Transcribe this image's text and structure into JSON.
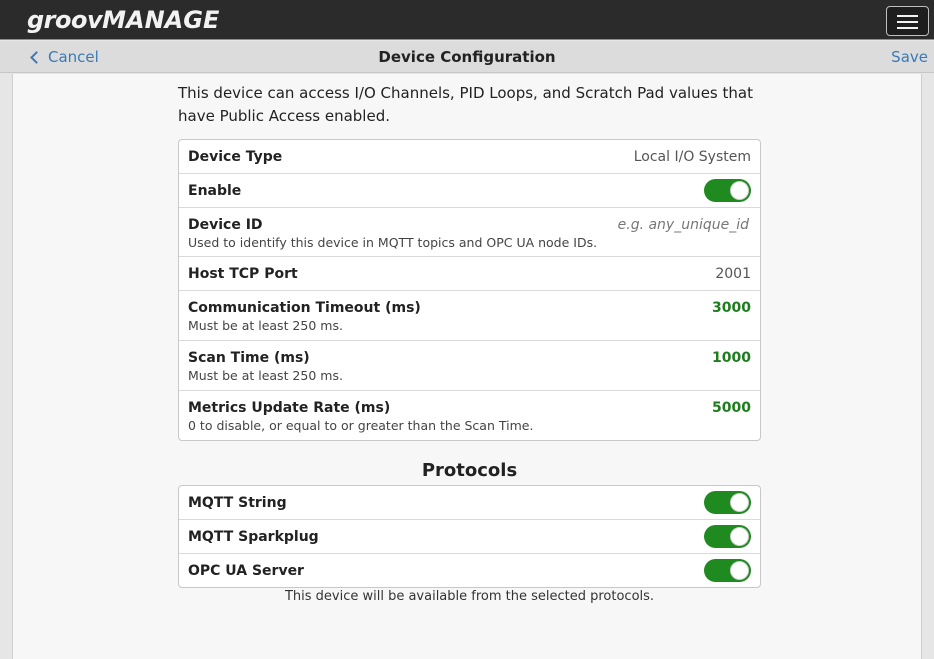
{
  "header": {
    "logo_part1": "groov",
    "logo_part2": "MANAGE",
    "menu_icon": "hamburger-menu-icon"
  },
  "nav": {
    "cancel_label": "Cancel",
    "title": "Device Configuration",
    "save_label": "Save"
  },
  "intro": "This device can access I/O Channels, PID Loops, and Scratch Pad values that have Public Access enabled.",
  "settings": {
    "device_type": {
      "label": "Device Type",
      "value": "Local I/O System"
    },
    "enable": {
      "label": "Enable",
      "on": true
    },
    "device_id": {
      "label": "Device ID",
      "placeholder": "e.g. any_unique_id",
      "sub": "Used to identify this device in MQTT topics and OPC UA node IDs."
    },
    "host_tcp_port": {
      "label": "Host TCP Port",
      "value": "2001"
    },
    "comm_timeout": {
      "label": "Communication Timeout (ms)",
      "value": "3000",
      "sub": "Must be at least 250 ms."
    },
    "scan_time": {
      "label": "Scan Time (ms)",
      "value": "1000",
      "sub": "Must be at least 250 ms."
    },
    "metrics_rate": {
      "label": "Metrics Update Rate (ms)",
      "value": "5000",
      "sub": "0 to disable, or equal to or greater than the Scan Time."
    }
  },
  "protocols": {
    "title": "Protocols",
    "items": [
      {
        "label": "MQTT String",
        "on": true
      },
      {
        "label": "MQTT Sparkplug",
        "on": true
      },
      {
        "label": "OPC UA Server",
        "on": true
      }
    ],
    "footnote": "This device will be available from the selected protocols."
  },
  "colors": {
    "toggle_on": "#1f8a1f",
    "link": "#3a7ab8",
    "value_green": "#1e7d1e",
    "topbar": "#2b2b2b"
  }
}
